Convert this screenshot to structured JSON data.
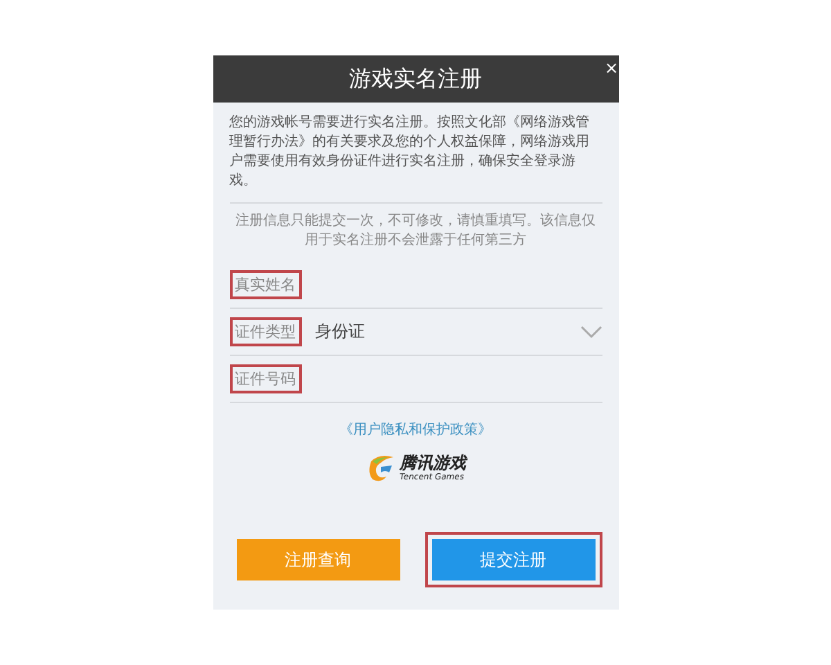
{
  "dialog": {
    "title": "游戏实名注册",
    "close": "×",
    "intro": "您的游戏帐号需要进行实名注册。按照文化部《网络游戏管理暂行办法》的有关要求及您的个人权益保障，网络游戏用户需要使用有效身份证件进行实名注册，确保安全登录游戏。",
    "notice": "注册信息只能提交一次，不可修改，请慎重填写。该信息仅用于实名注册不会泄露于任何第三方",
    "fields": [
      {
        "kind": "text",
        "label": "真实姓名",
        "highlighted": true
      },
      {
        "kind": "select",
        "label": "证件类型",
        "value": "身份证",
        "highlighted": true
      },
      {
        "kind": "text",
        "label": "证件号码",
        "highlighted": true
      }
    ],
    "policy_link": "《用户隐私和保护政策》",
    "logo": {
      "name": "腾讯游戏",
      "subtitle": "Tencent Games"
    },
    "buttons": [
      {
        "label": "注册查询",
        "kind": "secondary",
        "highlighted": false
      },
      {
        "label": "提交注册",
        "kind": "primary",
        "highlighted": true
      }
    ]
  }
}
